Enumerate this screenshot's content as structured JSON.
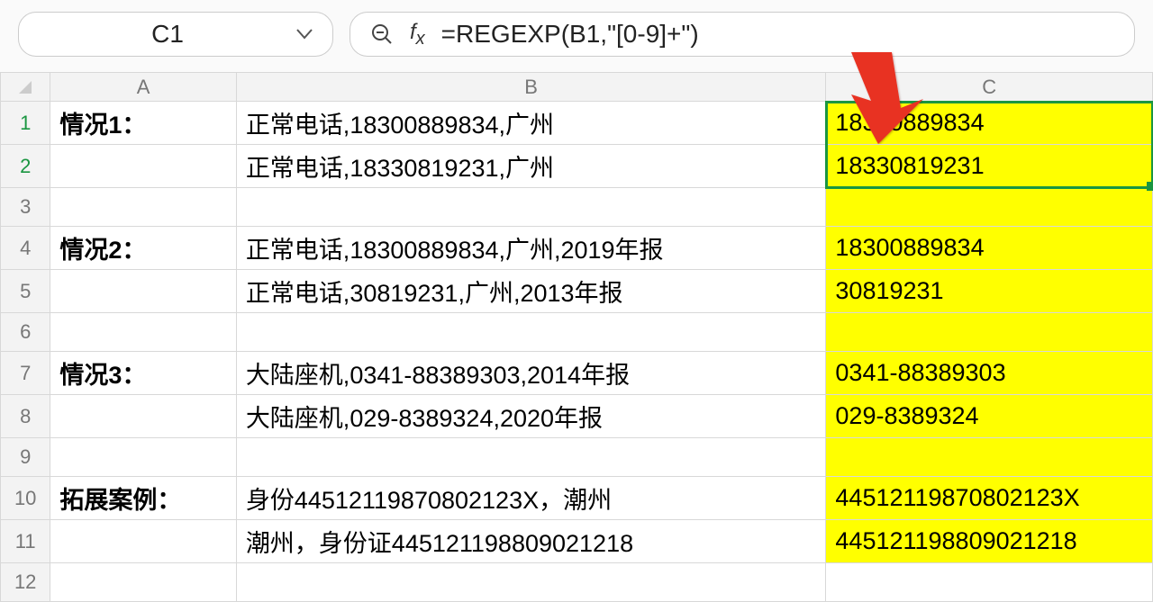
{
  "toolbar": {
    "cell_ref": "C1",
    "formula": "=REGEXP(B1,\"[0-9]+\")"
  },
  "columns": [
    "A",
    "B",
    "C"
  ],
  "rows": [
    {
      "n": 1,
      "a": "情况1：",
      "a_bold": true,
      "b": "正常电话,18300889834,广州",
      "c": "18300889834",
      "c_hl": true,
      "sel": true
    },
    {
      "n": 2,
      "a": "",
      "a_bold": false,
      "b": "正常电话,18330819231,广州",
      "c": "18330819231",
      "c_hl": true,
      "sel": true
    },
    {
      "n": 3,
      "a": "",
      "a_bold": false,
      "b": "",
      "c": "",
      "c_hl": true
    },
    {
      "n": 4,
      "a": "情况2：",
      "a_bold": true,
      "b": "正常电话,18300889834,广州,2019年报",
      "c": "18300889834",
      "c_hl": true
    },
    {
      "n": 5,
      "a": "",
      "a_bold": false,
      "b": "正常电话,30819231,广州,2013年报",
      "c": "30819231",
      "c_hl": true
    },
    {
      "n": 6,
      "a": "",
      "a_bold": false,
      "b": "",
      "c": "",
      "c_hl": true
    },
    {
      "n": 7,
      "a": "情况3：",
      "a_bold": true,
      "b": "大陆座机,0341-88389303,2014年报",
      "c": "0341-88389303",
      "c_hl": true
    },
    {
      "n": 8,
      "a": "",
      "a_bold": false,
      "b": "大陆座机,029-8389324,2020年报",
      "c": "029-8389324",
      "c_hl": true
    },
    {
      "n": 9,
      "a": "",
      "a_bold": false,
      "b": "",
      "c": "",
      "c_hl": true
    },
    {
      "n": 10,
      "a": "拓展案例：",
      "a_bold": true,
      "b": "身份44512119870802123X，潮州",
      "c": "44512119870802123X",
      "c_hl": true
    },
    {
      "n": 11,
      "a": "",
      "a_bold": false,
      "b": "潮州，身份证445121198809021218",
      "c": "445121198809021218",
      "c_hl": true
    },
    {
      "n": 12,
      "a": "",
      "a_bold": false,
      "b": "",
      "c": "",
      "c_hl": false
    }
  ]
}
